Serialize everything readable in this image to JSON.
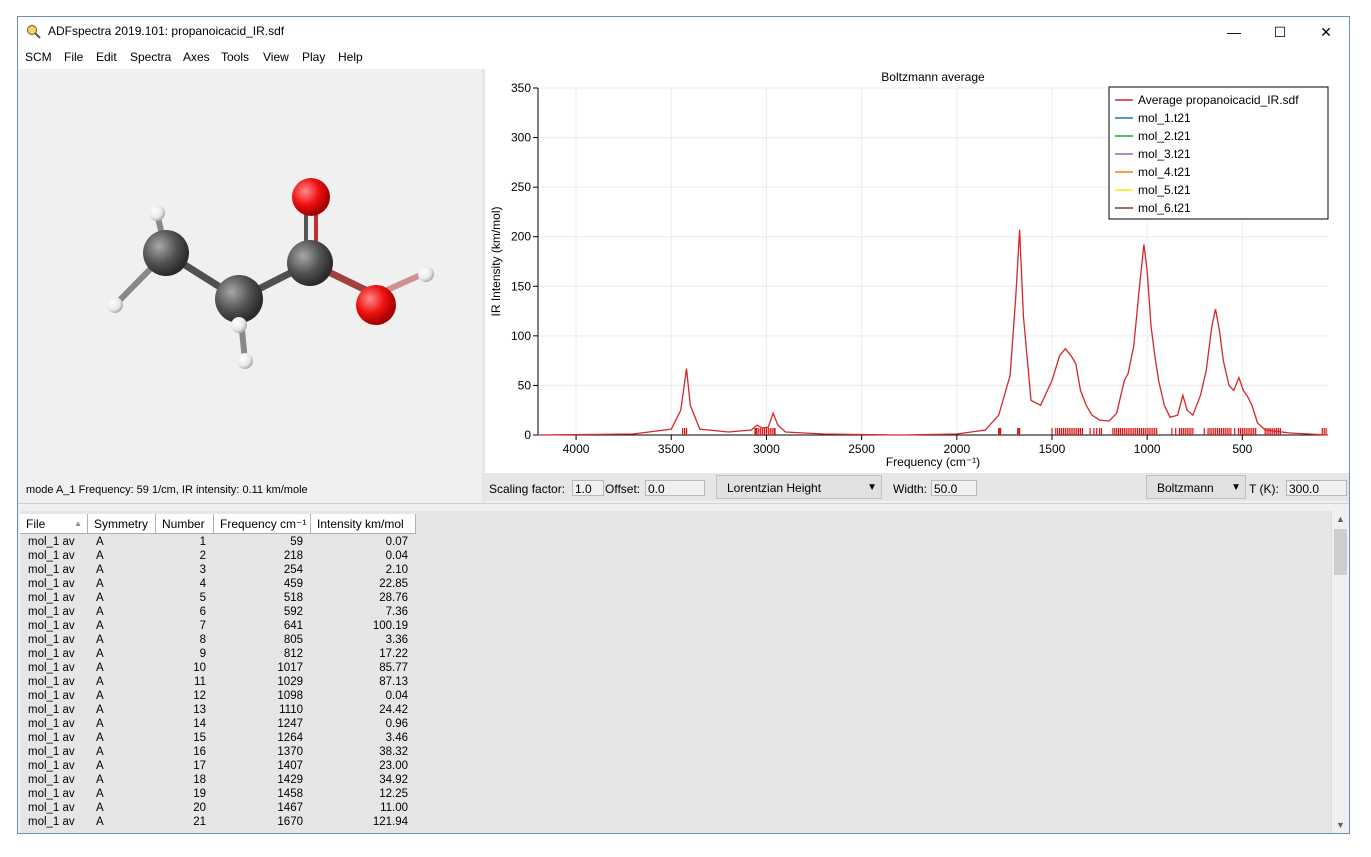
{
  "window": {
    "title": "ADFspectra 2019.101: propanoicacid_IR.sdf",
    "minimize": "—",
    "maximize": "☐",
    "close": "✕"
  },
  "menu": [
    "SCM",
    "File",
    "Edit",
    "Spectra",
    "Axes",
    "Tools",
    "View",
    "Play",
    "Help"
  ],
  "mode_info": "mode A_1 Frequency:   59 1/cm, IR intensity:   0.11 km/mole",
  "chart_data": {
    "type": "line",
    "title": "Boltzmann average",
    "xlabel": "Frequency (cm⁻¹)",
    "ylabel": "IR Intensity (km/mol)",
    "xlim": [
      4200,
      50
    ],
    "ylim": [
      0,
      350
    ],
    "x_ticks": [
      4000,
      3500,
      3000,
      2500,
      2000,
      1500,
      1000,
      500
    ],
    "y_ticks": [
      0,
      50,
      100,
      150,
      200,
      250,
      300,
      350
    ],
    "grid": true,
    "legend_position": "top-right",
    "legend": [
      {
        "name": "Average propanoicacid_IR.sdf",
        "color": "#d62728"
      },
      {
        "name": "mol_1.t21",
        "color": "#1f77b4"
      },
      {
        "name": "mol_2.t21",
        "color": "#2ca02c"
      },
      {
        "name": "mol_3.t21",
        "color": "#9467bd"
      },
      {
        "name": "mol_4.t21",
        "color": "#ff7f0e"
      },
      {
        "name": "mol_5.t21",
        "color": "#ffe600"
      },
      {
        "name": "mol_6.t21",
        "color": "#8c3c2c"
      }
    ],
    "series": [
      {
        "name": "Average propanoicacid_IR.sdf",
        "color": "#d62728",
        "points": [
          [
            4200,
            0
          ],
          [
            3700,
            1
          ],
          [
            3500,
            6
          ],
          [
            3450,
            25
          ],
          [
            3420,
            67
          ],
          [
            3400,
            30
          ],
          [
            3350,
            6
          ],
          [
            3200,
            3
          ],
          [
            3080,
            5
          ],
          [
            3050,
            10
          ],
          [
            3020,
            7
          ],
          [
            2990,
            8
          ],
          [
            2965,
            22
          ],
          [
            2940,
            10
          ],
          [
            2900,
            3
          ],
          [
            2700,
            1
          ],
          [
            2300,
            0
          ],
          [
            2000,
            1
          ],
          [
            1850,
            5
          ],
          [
            1780,
            20
          ],
          [
            1720,
            60
          ],
          [
            1690,
            140
          ],
          [
            1670,
            207
          ],
          [
            1650,
            120
          ],
          [
            1610,
            35
          ],
          [
            1560,
            30
          ],
          [
            1500,
            55
          ],
          [
            1460,
            80
          ],
          [
            1430,
            87
          ],
          [
            1400,
            80
          ],
          [
            1375,
            72
          ],
          [
            1350,
            45
          ],
          [
            1320,
            30
          ],
          [
            1290,
            20
          ],
          [
            1250,
            15
          ],
          [
            1200,
            14
          ],
          [
            1160,
            22
          ],
          [
            1120,
            55
          ],
          [
            1100,
            62
          ],
          [
            1070,
            90
          ],
          [
            1040,
            150
          ],
          [
            1017,
            192
          ],
          [
            1000,
            165
          ],
          [
            980,
            110
          ],
          [
            960,
            80
          ],
          [
            940,
            55
          ],
          [
            910,
            30
          ],
          [
            880,
            18
          ],
          [
            840,
            20
          ],
          [
            812,
            40
          ],
          [
            790,
            25
          ],
          [
            760,
            20
          ],
          [
            720,
            40
          ],
          [
            690,
            65
          ],
          [
            660,
            110
          ],
          [
            641,
            127
          ],
          [
            620,
            105
          ],
          [
            600,
            75
          ],
          [
            570,
            50
          ],
          [
            545,
            45
          ],
          [
            518,
            58
          ],
          [
            495,
            45
          ],
          [
            470,
            38
          ],
          [
            450,
            30
          ],
          [
            420,
            12
          ],
          [
            380,
            5
          ],
          [
            250,
            2
          ],
          [
            50,
            0
          ]
        ]
      }
    ],
    "stick_positions": [
      3440,
      3430,
      3420,
      3060,
      3055,
      3050,
      3040,
      3030,
      3020,
      3010,
      3000,
      2990,
      2980,
      2970,
      2960,
      2955,
      1780,
      1775,
      1770,
      1680,
      1675,
      1670,
      1500,
      1480,
      1470,
      1460,
      1450,
      1440,
      1430,
      1420,
      1410,
      1400,
      1390,
      1380,
      1370,
      1360,
      1350,
      1340,
      1300,
      1280,
      1265,
      1250,
      1240,
      1180,
      1170,
      1160,
      1150,
      1140,
      1130,
      1120,
      1110,
      1100,
      1090,
      1080,
      1070,
      1060,
      1050,
      1040,
      1030,
      1020,
      1010,
      1000,
      990,
      980,
      970,
      960,
      950,
      870,
      850,
      830,
      820,
      810,
      800,
      790,
      780,
      770,
      760,
      700,
      680,
      670,
      660,
      650,
      640,
      630,
      620,
      610,
      600,
      590,
      580,
      570,
      560,
      540,
      520,
      510,
      500,
      490,
      480,
      470,
      460,
      450,
      440,
      430,
      380,
      370,
      360,
      350,
      340,
      330,
      320,
      310,
      300,
      80,
      70,
      60
    ]
  },
  "controls": {
    "scaling_label": "Scaling factor:",
    "scaling_value": "1.0",
    "offset_label": "Offset:",
    "offset_value": "0.0",
    "lineshape": "Lorentzian Height",
    "width_label": "Width:",
    "width_value": "50.0",
    "averaging": "Boltzmann",
    "temp_label": "T (K):",
    "temp_value": "300.0"
  },
  "table": {
    "headers": [
      "File",
      "Symmetry",
      "Number",
      "Frequency cm⁻¹",
      "Intensity km/mol"
    ],
    "rows": [
      [
        "mol_1 av",
        "A",
        "1",
        "59",
        "0.07"
      ],
      [
        "mol_1 av",
        "A",
        "2",
        "218",
        "0.04"
      ],
      [
        "mol_1 av",
        "A",
        "3",
        "254",
        "2.10"
      ],
      [
        "mol_1 av",
        "A",
        "4",
        "459",
        "22.85"
      ],
      [
        "mol_1 av",
        "A",
        "5",
        "518",
        "28.76"
      ],
      [
        "mol_1 av",
        "A",
        "6",
        "592",
        "7.36"
      ],
      [
        "mol_1 av",
        "A",
        "7",
        "641",
        "100.19"
      ],
      [
        "mol_1 av",
        "A",
        "8",
        "805",
        "3.36"
      ],
      [
        "mol_1 av",
        "A",
        "9",
        "812",
        "17.22"
      ],
      [
        "mol_1 av",
        "A",
        "10",
        "1017",
        "85.77"
      ],
      [
        "mol_1 av",
        "A",
        "11",
        "1029",
        "87.13"
      ],
      [
        "mol_1 av",
        "A",
        "12",
        "1098",
        "0.04"
      ],
      [
        "mol_1 av",
        "A",
        "13",
        "1110",
        "24.42"
      ],
      [
        "mol_1 av",
        "A",
        "14",
        "1247",
        "0.96"
      ],
      [
        "mol_1 av",
        "A",
        "15",
        "1264",
        "3.46"
      ],
      [
        "mol_1 av",
        "A",
        "16",
        "1370",
        "38.32"
      ],
      [
        "mol_1 av",
        "A",
        "17",
        "1407",
        "23.00"
      ],
      [
        "mol_1 av",
        "A",
        "18",
        "1429",
        "34.92"
      ],
      [
        "mol_1 av",
        "A",
        "19",
        "1458",
        "12.25"
      ],
      [
        "mol_1 av",
        "A",
        "20",
        "1467",
        "11.00"
      ],
      [
        "mol_1 av",
        "A",
        "21",
        "1670",
        "121.94"
      ]
    ]
  }
}
